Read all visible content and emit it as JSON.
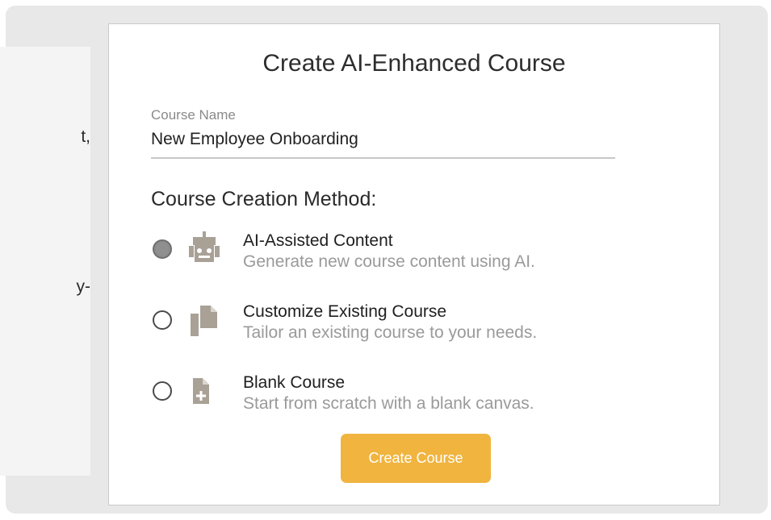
{
  "background_fragments": {
    "line1": "t,",
    "line2": "y-"
  },
  "dialog": {
    "title": "Create AI-Enhanced Course",
    "course_name": {
      "label": "Course Name",
      "value": "New Employee Onboarding"
    },
    "method_heading": "Course Creation Method:",
    "options": [
      {
        "title": "AI-Assisted Content",
        "description": "Generate new course content using AI.",
        "icon": "robot-icon",
        "selected": true
      },
      {
        "title": "Customize Existing Course",
        "description": "Tailor an existing course to your needs.",
        "icon": "copy-documents-icon",
        "selected": false
      },
      {
        "title": "Blank Course",
        "description": "Start from scratch with a blank canvas.",
        "icon": "new-file-icon",
        "selected": false
      }
    ],
    "create_button_label": "Create Course"
  },
  "colors": {
    "accent": "#f0b43f",
    "icon": "#a9a196",
    "muted_text": "#9a9a9a"
  }
}
